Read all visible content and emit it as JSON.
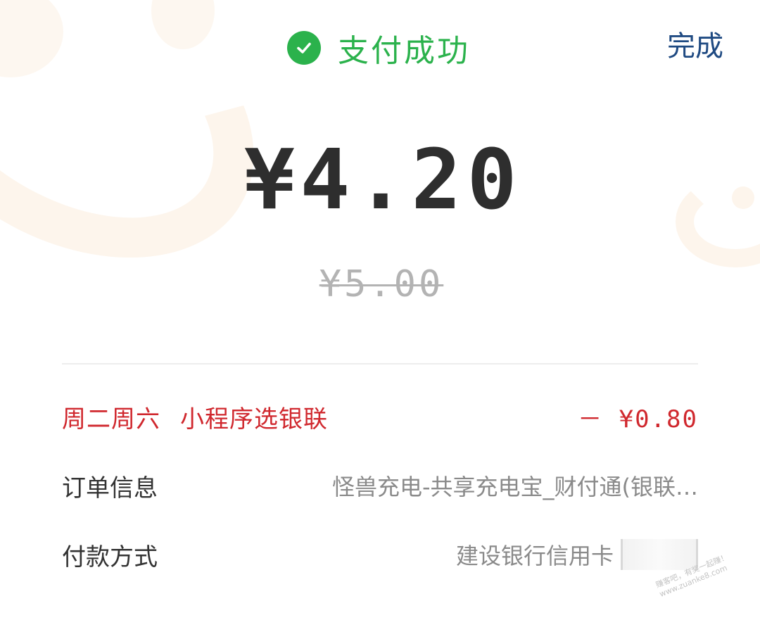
{
  "header": {
    "status": "支付成功",
    "done_label": "完成",
    "status_color": "#2bb24c",
    "done_color": "#1f4a82",
    "status_icon": "check-circle-icon"
  },
  "amount": {
    "paid": "¥4.20",
    "original": "¥5.00"
  },
  "promotion": {
    "days": "周二周六",
    "name": "小程序选银联",
    "discount": "－ ¥0.80",
    "color": "#d0282e"
  },
  "order_info": {
    "label": "订单信息",
    "value": "怪兽充电-共享充电宝_财付通(银联…"
  },
  "payment_method": {
    "label": "付款方式",
    "value": "建设银行信用卡"
  },
  "watermark": {
    "line1": "赚客吧，有奖一起赚！",
    "line2": "www.zuanke8.com"
  }
}
